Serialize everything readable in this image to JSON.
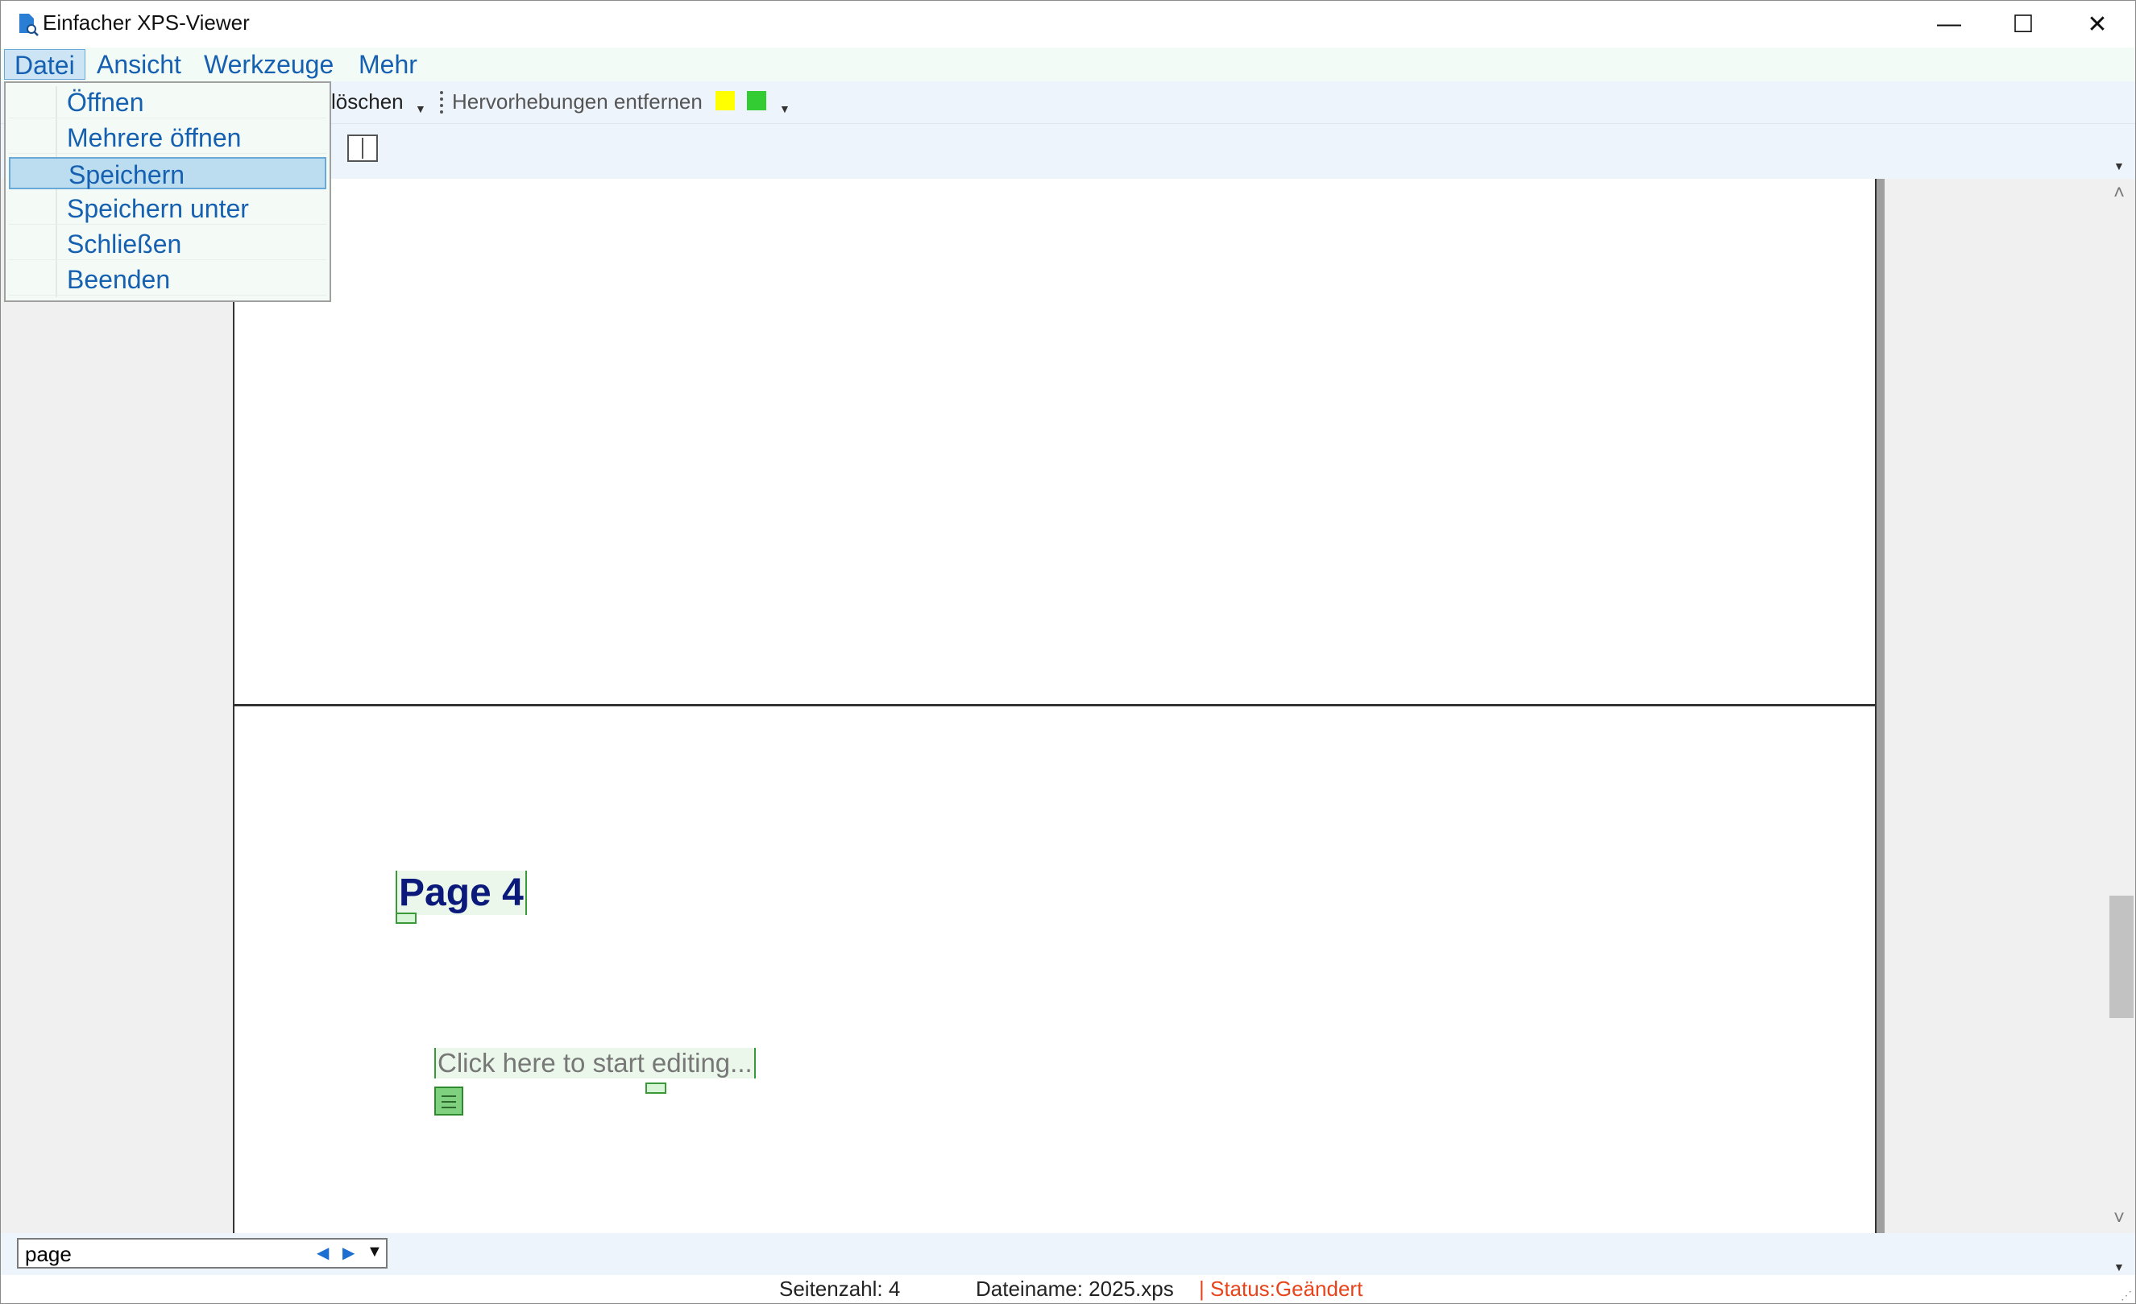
{
  "window": {
    "title": "Einfacher XPS-Viewer",
    "minimize_glyph": "—",
    "maximize_glyph": "☐",
    "close_glyph": "✕"
  },
  "menubar": {
    "items": [
      "Datei",
      "Ansicht",
      "Werkzeuge",
      "Mehr"
    ]
  },
  "file_menu": {
    "items": [
      "Öffnen",
      "Mehrere öffnen",
      "Speichern",
      "Speichern unter",
      "Schließen",
      "Beenden"
    ],
    "selected": "Speichern"
  },
  "toolbar": {
    "delete_label": "löschen",
    "remove_highlights_label": "Hervorhebungen entfernen",
    "highlight_colors": [
      "#ffff00",
      "#33cc33"
    ]
  },
  "document": {
    "page_heading": "Page 4",
    "page_paragraph": "Click here to start editing..."
  },
  "search": {
    "value": "page"
  },
  "status": {
    "page_count": "Seitenzahl: 4",
    "filename": "Dateiname: 2025.xps",
    "state": "| Status:Geändert"
  }
}
